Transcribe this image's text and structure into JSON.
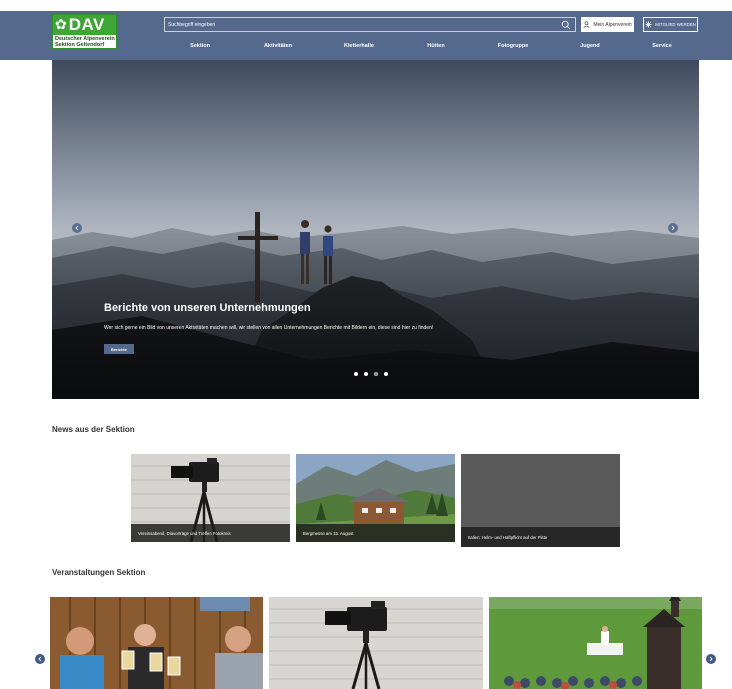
{
  "logo": {
    "brand": "DAV",
    "line1": "Deutscher Alpenverein",
    "line2": "Sektion Geltendorf"
  },
  "search": {
    "placeholder": "Suchbegriff eingeben",
    "icon": "search-icon"
  },
  "header_buttons": {
    "login": "Mein Alpenverein",
    "member": "Mitglied werden"
  },
  "nav": {
    "items": [
      "Sektion",
      "Aktivitäten",
      "Kletterhalle",
      "Hütten",
      "Fotogruppe",
      "Jugend",
      "Service"
    ]
  },
  "hero": {
    "title": "Berichte von unseren Unternehmungen",
    "text": "Wer sich gerne ein Bild von unseren Aktivitäten machen will, wir stellen von allen Unternehmungen Berichte mit Bildern ein, diese sind hier zu finden!",
    "button": "Berichte",
    "slide_count": 4,
    "active_slide": 3
  },
  "news": {
    "heading": "News aus der Sektion",
    "cards": [
      {
        "caption": "Vereinsabend, Diavorträge und Treffen Fotokreis"
      },
      {
        "caption": "Bergmesse am 15. August"
      },
      {
        "caption": "Italien: Helm- und Haftpflicht auf der Piste"
      }
    ]
  },
  "events": {
    "heading": "Veranstaltungen Sektion"
  },
  "colors": {
    "header": "#55698c",
    "logo_green": "#3fa535",
    "arrow": "#5b6f94"
  }
}
